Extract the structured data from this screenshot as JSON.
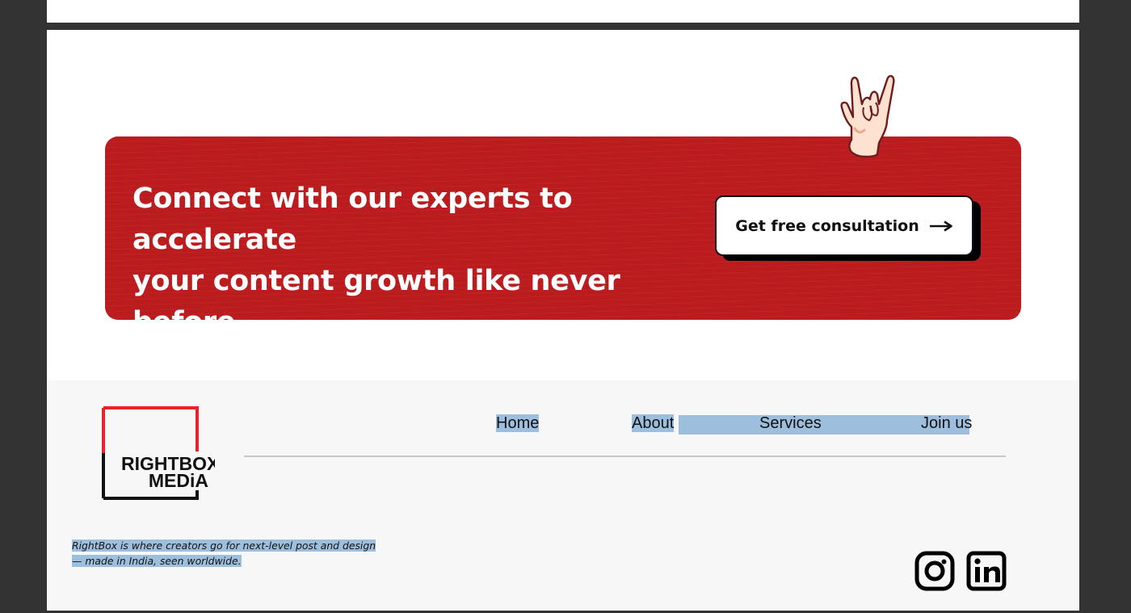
{
  "cta": {
    "heading_line1": "Connect with our experts to accelerate",
    "heading_line2": "your content growth like never before",
    "button_label": "Get free consultation",
    "arrow": "⟶",
    "banner_color": "#bd1c1f"
  },
  "footer": {
    "logo": {
      "line1": "RIGHTBOX",
      "line2": "MEDiA",
      "frame_red": "#e8222a"
    },
    "nav": [
      {
        "label": "Home"
      },
      {
        "label": "About"
      },
      {
        "label": "Services"
      },
      {
        "label": "Join us"
      }
    ],
    "tagline_line1": "RightBox is where creators go for next-level post and design",
    "tagline_line2": "— made in India, seen worldwide.",
    "social": [
      "instagram-icon",
      "linkedin-icon"
    ],
    "highlight_color": "#9dbfdd"
  }
}
